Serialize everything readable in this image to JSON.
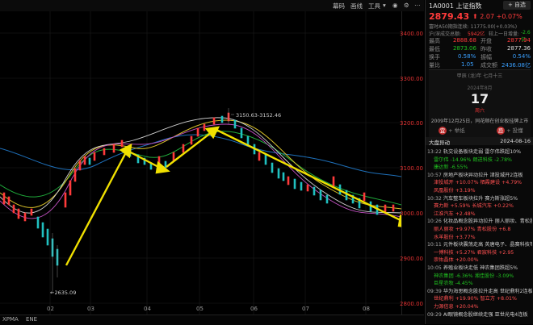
{
  "toolbar": {
    "items": [
      "幕码",
      "画线",
      "工具",
      "▾"
    ],
    "icons": [
      "person-icon",
      "settings-icon",
      "more-icon"
    ]
  },
  "y_axis": {
    "ticks": [
      "3400.00",
      "3300.00",
      "3200.00",
      "3100.00",
      "3000.00",
      "2900.00",
      "2800.00",
      "2700.00"
    ]
  },
  "x_axis": {
    "ticks": [
      "02",
      "03",
      "04",
      "05",
      "06",
      "07",
      "08"
    ]
  },
  "annotations": {
    "high": "3150.63-3152.46",
    "low": "←2635.09"
  },
  "bottom_tabs": [
    "XPMA",
    "ENE"
  ],
  "panel": {
    "code": "1A0001",
    "name": "上证指数",
    "add_btn": "+ 自选",
    "price": "2879.43",
    "arrow": "⬆",
    "change": "2.07",
    "change_pct": "+0.07%",
    "line1": "富时A50期指连续: 11775.00(+0.03%)",
    "line2_label": "沪/深成交总额:",
    "line2_value": "5942亿",
    "line2b_label": "较上一日增量:",
    "line2b_value": "-2.6亿",
    "rows": [
      {
        "l1": "最高",
        "v1": "2888.68",
        "l2": "开盘",
        "v2": "2877.94"
      },
      {
        "l1": "最低",
        "v1": "2873.06",
        "l2": "昨收",
        "v2": "2877.36"
      },
      {
        "l1": "换手",
        "v1": "0.58%",
        "l2": "振幅",
        "v2": "0.54%"
      },
      {
        "l1": "量比",
        "v1": "1.05",
        "l2": "成交额",
        "v2": "2436.08亿"
      }
    ],
    "calendar": {
      "header": "甲辰 (龙)年 七月十三",
      "date_small": "2024年8月",
      "day": "17",
      "weekday": "周六",
      "event": "2009年12月25日，同花顺在创业板挂牌上市",
      "btn_buy": "宜",
      "btn_buy_label": "+ 举纸",
      "btn_sell": "忌",
      "btn_sell_label": "+ 投懂"
    },
    "news_header": {
      "title": "大盘异动",
      "date": "2024-08-16"
    },
    "news": [
      {
        "time": "13:22",
        "text": "轨交设备板块走弱 雷尔伟跌超10%"
      },
      {
        "time": "",
        "text": "雷尔伟 -14.96%   朗进科技 -2.78%"
      },
      {
        "time": "",
        "text": "康达新 -6.55%"
      },
      {
        "time": "10:57",
        "text": "房地产板块异动拉升 津投城开2连板"
      },
      {
        "time": "",
        "text": "津投城开 +10.07%  栖霞建设 +4.79%"
      },
      {
        "time": "",
        "text": "凤凰股份 +3.19%"
      },
      {
        "time": "10:32",
        "text": "汽车整车板块拉升 赛力斯涨超5%"
      },
      {
        "time": "",
        "text": "赛力斯 +5.59%   长城汽车 +0.22%"
      },
      {
        "time": "",
        "text": "江淮汽车 +2.48%"
      },
      {
        "time": "10:26",
        "text": "化妆品概念股异动拉升 丽人丽妆、青松股份"
      },
      {
        "time": "",
        "text": "丽人丽妆 +9.97%  青松股份 +6.8"
      },
      {
        "time": "",
        "text": "水羊股份 +3.77%"
      },
      {
        "time": "10:11",
        "text": "元件板块震荡走高 英唐电子、晶赛科技等"
      },
      {
        "time": "",
        "text": "一博科技 +5.27%  君宸科技 +2.95"
      },
      {
        "time": "",
        "text": "崇佑晶体 +20.00%"
      },
      {
        "time": "10:05",
        "text": "养殖业板块走低 神农集团跌超5%"
      },
      {
        "time": "",
        "text": "神农集团 -6.36%  湘佳股份 -3.09%"
      },
      {
        "time": "",
        "text": "巨星农牧 -4.45%"
      },
      {
        "time": "09:39",
        "text": "华为海思概念股拉升走高 世纪鼎利2连板"
      },
      {
        "time": "",
        "text": "世纪鼎利 +19.90%  智立方 +8.01%"
      },
      {
        "time": "",
        "text": "力源信息 +20.04%"
      },
      {
        "time": "09:29",
        "text": "AI眼镜概念股继续走强 亚世光电4连板"
      }
    ]
  }
}
